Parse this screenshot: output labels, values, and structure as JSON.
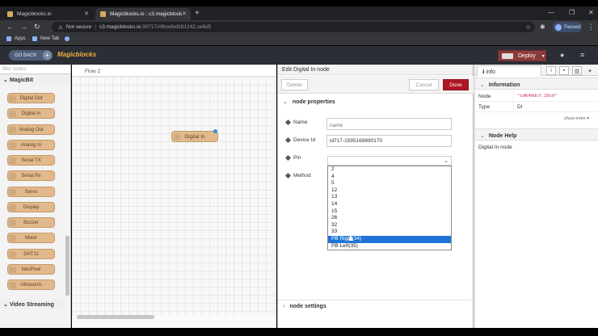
{
  "browser": {
    "tabs": [
      {
        "title": "Magicblocks.io"
      },
      {
        "title": "Magicblocks.io : c3.magicblock"
      }
    ],
    "url_secure_label": "Not secure",
    "url_host": "c3.magicblocks.io",
    "url_path": ":30717/#flow/bd281242.ce6d5",
    "profile_label": "Paused",
    "bookmarks": [
      "Apps",
      "New Tab"
    ]
  },
  "header": {
    "go_back": "GO BACK",
    "brand": "Magicblocks",
    "deploy": "Deploy"
  },
  "palette": {
    "filter_placeholder": "filter nodes",
    "category": "MagicBit",
    "nodes": [
      "Digital Out",
      "Digital In",
      "Analog Out",
      "Analog In",
      "Serial TX",
      "Serial Rx",
      "Servo",
      "Display",
      "Buzzer",
      "Motor",
      "DHT11",
      "NeoPixel",
      "Ultrasonic"
    ],
    "category2": "Video Streaming"
  },
  "workspace": {
    "flow_tab": "Flow 2",
    "node_label": "Digital In"
  },
  "tray": {
    "title": "Edit Digital In node",
    "delete": "Delete",
    "cancel": "Cancel",
    "done": "Done",
    "section_props": "node properties",
    "name_label": "Name",
    "name_placeholder": "name",
    "device_label": "Device Id",
    "device_value": "id717-1595169890170",
    "pin_label": "Pin",
    "method_label": "Method",
    "pin_options": [
      "2",
      "4",
      "5",
      "12",
      "13",
      "14",
      "15",
      "26",
      "32",
      "33",
      "PB Right(34)",
      "PB Left(35)"
    ],
    "pin_selected": "PB Right(34)",
    "section_settings": "node settings"
  },
  "sidebar": {
    "tab": "info",
    "information": "Information",
    "node_key": "Node",
    "node_value": "\"cd649dcf.19c9\"",
    "type_key": "Type",
    "type_value": "DI",
    "show_more": "show more ▾",
    "help_head": "Node Help",
    "help_text": "Digital In node"
  }
}
